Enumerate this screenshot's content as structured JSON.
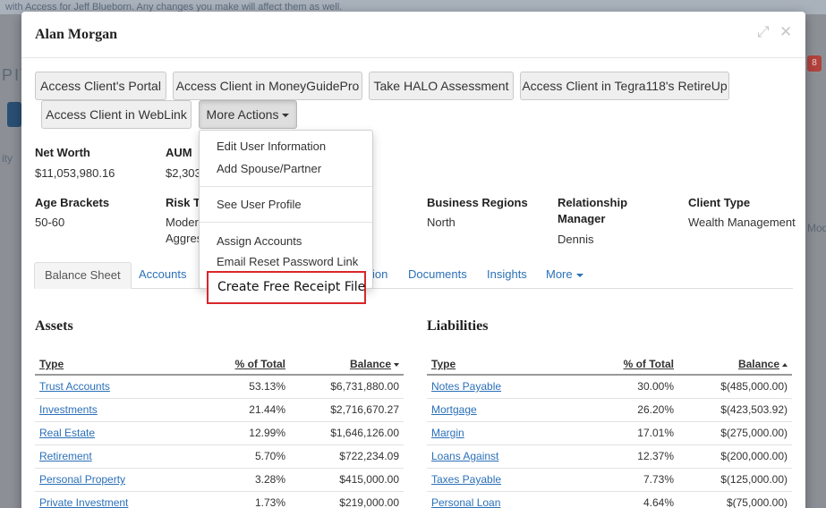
{
  "background": {
    "topbar_text": "with Access for Jeff Blueborn. Any changes you make will affect them as well.",
    "left_fragment": "PIT",
    "left_fragment2": "ity",
    "right_fragment": "Mod",
    "badge": "8"
  },
  "modal": {
    "title": "Alan Morgan",
    "expand_icon": "expand-icon",
    "close_icon": "close-icon"
  },
  "actions": {
    "portal": "Access Client's Portal",
    "moneyguide": "Access Client in MoneyGuidePro",
    "halo": "Take HALO Assessment",
    "tegra": "Access Client in Tegra118's RetireUp",
    "weblink": "Access Client in WebLink",
    "more": "More Actions"
  },
  "summary": {
    "net_worth_label": "Net Worth",
    "net_worth_value": "$11,053,980.16",
    "aum_label": "AUM",
    "aum_value": "$2,303",
    "age_label": "Age Brackets",
    "age_value": "50-60",
    "risk_label": "Risk T",
    "risk_value1": "Moder",
    "risk_value2": "Aggres",
    "regions_label": "Business Regions",
    "regions_value": "North",
    "rm_label1": "Relationship",
    "rm_label2": "Manager",
    "rm_value": "Dennis",
    "type_label": "Client Type",
    "type_value": "Wealth Management"
  },
  "tabs": {
    "balance_sheet": "Balance Sheet",
    "accounts": "Accounts",
    "partial": "ion",
    "documents": "Documents",
    "insights": "Insights",
    "more": "More"
  },
  "dropdown": {
    "edit_user": "Edit User Information",
    "add_spouse": "Add Spouse/Partner",
    "see_profile": "See User Profile",
    "assign_accounts": "Assign Accounts",
    "email_reset": "Email Reset Password Link",
    "create_receipt": "Create Free Receipt File"
  },
  "assets": {
    "title": "Assets",
    "headers": [
      "Type",
      "% of Total",
      "Balance"
    ],
    "rows": [
      [
        "Trust Accounts",
        "53.13%",
        "$6,731,880.00"
      ],
      [
        "Investments",
        "21.44%",
        "$2,716,670.27"
      ],
      [
        "Real Estate",
        "12.99%",
        "$1,646,126.00"
      ],
      [
        "Retirement",
        "5.70%",
        "$722,234.09"
      ],
      [
        "Personal Property",
        "3.28%",
        "$415,000.00"
      ],
      [
        "Private Investment",
        "1.73%",
        "$219,000.00"
      ]
    ]
  },
  "liabilities": {
    "title": "Liabilities",
    "headers": [
      "Type",
      "% of Total",
      "Balance"
    ],
    "rows": [
      [
        "Notes Payable",
        "30.00%",
        "$(485,000.00)"
      ],
      [
        "Mortgage",
        "26.20%",
        "$(423,503.92)"
      ],
      [
        "Margin",
        "17.01%",
        "$(275,000.00)"
      ],
      [
        "Loans Against",
        "12.37%",
        "$(200,000.00)"
      ],
      [
        "Taxes Payable",
        "7.73%",
        "$(125,000.00)"
      ],
      [
        "Personal Loan",
        "4.64%",
        "$(75,000.00)"
      ]
    ]
  }
}
